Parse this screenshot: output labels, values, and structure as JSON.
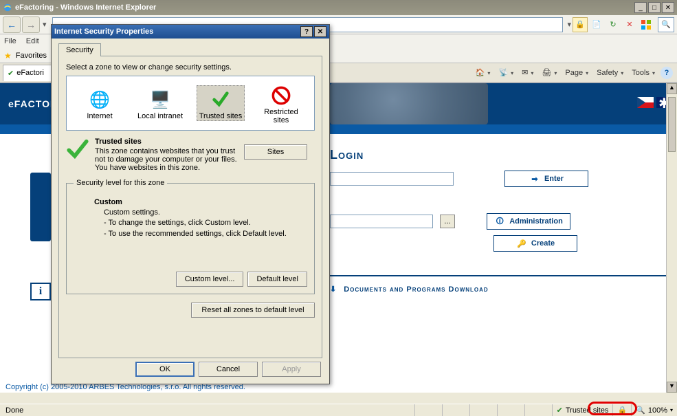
{
  "window": {
    "title": "eFactoring - Windows Internet Explorer",
    "min": "_",
    "max": "□",
    "close": "✕"
  },
  "menu": {
    "file": "File",
    "edit": "Edit"
  },
  "favbar": {
    "label": "Favorites"
  },
  "tab": {
    "label": "eFactori"
  },
  "toolstrip": {
    "page": "Page",
    "safety": "Safety",
    "tools": "Tools"
  },
  "brand": "eFACTORING",
  "login": {
    "header": "Login",
    "enter": "Enter",
    "administration": "Administration",
    "create": "Create",
    "browse": "..."
  },
  "download": {
    "label": "Documents and Programs Download"
  },
  "copyright": "Copyright (c) 2005-2010 ARBES Technologies, s.r.o. All rights reserved.",
  "status": {
    "done": "Done",
    "trusted": "Trusted sites",
    "zoom": "100%"
  },
  "dialog": {
    "title": "Internet Security Properties",
    "help": "?",
    "close": "✕",
    "tab": "Security",
    "zoneprompt": "Select a zone to view or change security settings.",
    "zones": {
      "internet": "Internet",
      "intranet": "Local intranet",
      "trusted": "Trusted sites",
      "restricted": "Restricted sites"
    },
    "sitesBtn": "Sites",
    "tsHeader": "Trusted sites",
    "tsDesc1": "This zone contains websites that you trust not to damage your computer or your files.",
    "tsDesc2": "You have websites in this zone.",
    "groupLegend": "Security level for this zone",
    "customHdr": "Custom",
    "customLine0": "Custom settings.",
    "customLine1": "- To change the settings, click Custom level.",
    "customLine2": "- To use the recommended settings, click Default level.",
    "customLevelBtn": "Custom level...",
    "defaultLevelBtn": "Default level",
    "resetBtn": "Reset all zones to default level",
    "ok": "OK",
    "cancel": "Cancel",
    "apply": "Apply"
  }
}
